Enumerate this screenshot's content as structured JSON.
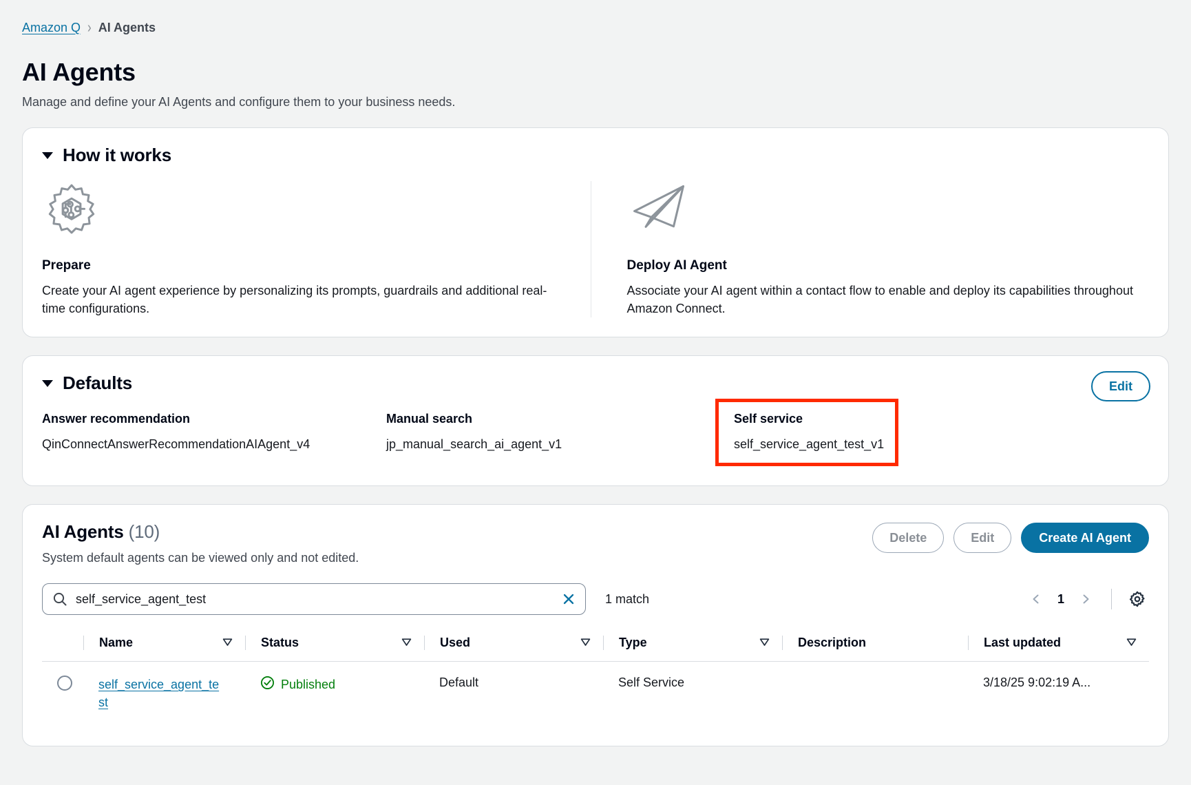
{
  "breadcrumb": {
    "root": "Amazon Q",
    "separator": "›",
    "current": "AI Agents"
  },
  "header": {
    "title": "AI Agents",
    "subtitle": "Manage and define your AI Agents and configure them to your business needs."
  },
  "how_it_works": {
    "section_title": "How it works",
    "items": [
      {
        "icon": "gear-ai-icon",
        "heading": "Prepare",
        "body": "Create your AI agent experience by personalizing its prompts, guardrails and additional real-time configurations."
      },
      {
        "icon": "paper-plane-icon",
        "heading": "Deploy AI Agent",
        "body": "Associate your AI agent within a contact flow to enable and deploy its capabilities throughout Amazon Connect."
      }
    ]
  },
  "defaults": {
    "section_title": "Defaults",
    "edit_label": "Edit",
    "fields": [
      {
        "label": "Answer recommendation",
        "value": "QinConnectAnswerRecommendationAIAgent_v4",
        "highlighted": false
      },
      {
        "label": "Manual search",
        "value": "jp_manual_search_ai_agent_v1",
        "highlighted": false
      },
      {
        "label": "Self service",
        "value": "self_service_agent_test_v1",
        "highlighted": true
      }
    ],
    "highlight_color": "#ff2a00"
  },
  "agents_panel": {
    "title": "AI Agents",
    "count": "(10)",
    "subtitle": "System default agents can be viewed only and not edited.",
    "buttons": {
      "delete": "Delete",
      "edit": "Edit",
      "create": "Create AI Agent"
    },
    "search": {
      "value": "self_service_agent_test",
      "placeholder": "Find AI agents",
      "icon": "search-icon",
      "clear_icon": "close-icon",
      "match_text": "1 match"
    },
    "pagination": {
      "prev_icon": "chevron-left-icon",
      "page": "1",
      "next_icon": "chevron-right-icon",
      "settings_icon": "gear-icon"
    },
    "table": {
      "columns": [
        {
          "label": "Name",
          "sortable": true
        },
        {
          "label": "Status",
          "sortable": true
        },
        {
          "label": "Used",
          "sortable": true
        },
        {
          "label": "Type",
          "sortable": true
        },
        {
          "label": "Description",
          "sortable": false
        },
        {
          "label": "Last updated",
          "sortable": true
        }
      ],
      "rows": [
        {
          "name": "self_service_agent_test",
          "status": "Published",
          "status_icon": "check-circle-icon",
          "used": "Default",
          "type": "Self Service",
          "description": "",
          "last_updated": "3/18/25 9:02:19 A..."
        }
      ]
    }
  },
  "colors": {
    "link": "#0972a3",
    "primary": "#0972a3",
    "success": "#037f0c",
    "highlight": "#ff2a00"
  }
}
